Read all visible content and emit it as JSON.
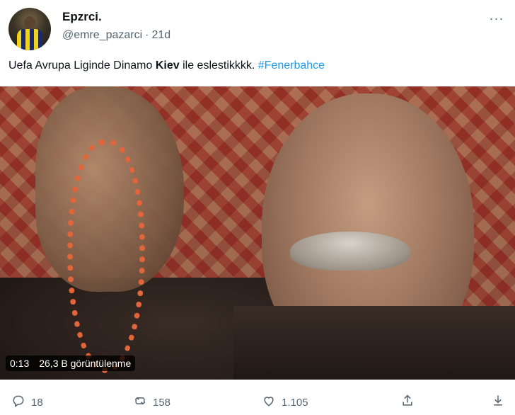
{
  "tweet": {
    "display_name": "Epzrci.",
    "handle": "@emre_pazarci",
    "separator": "·",
    "time": "21d",
    "text_before": "Uefa Avrupa Liginde Dinamo ",
    "text_bold": "Kiev",
    "text_after": " ile eslestikkkk. ",
    "hashtag": "#Fenerbahce",
    "more_label": "···"
  },
  "media": {
    "duration": "0:13",
    "views": "26,3 B görüntülenme"
  },
  "actions": {
    "replies": "18",
    "retweets": "158",
    "likes": "1.105"
  },
  "colors": {
    "accent": "#1d9bf0",
    "muted": "#536471",
    "text": "#0f1419"
  },
  "icons": {
    "reply": "reply-icon",
    "retweet": "retweet-icon",
    "like": "heart-icon",
    "share": "share-icon",
    "download": "download-icon",
    "more": "more-icon"
  }
}
